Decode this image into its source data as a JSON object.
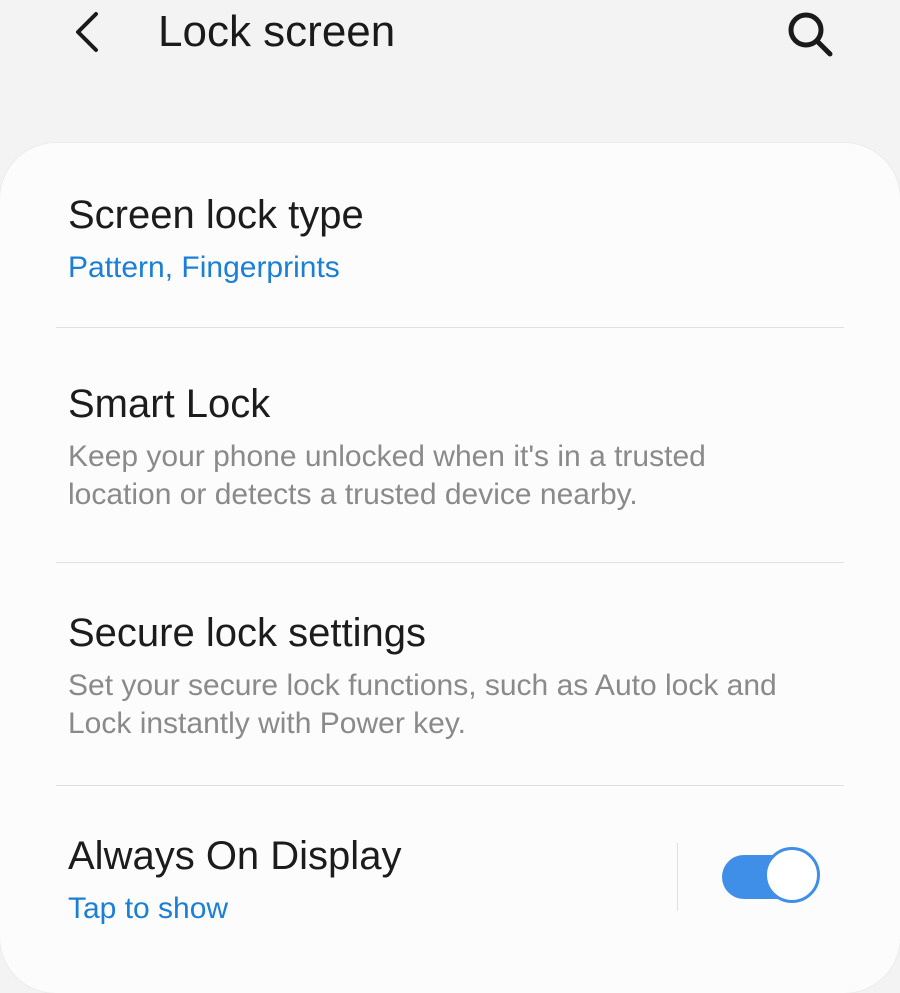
{
  "header": {
    "title": "Lock screen",
    "back_icon": "chevron-left-icon",
    "search_icon": "search-icon"
  },
  "settings": [
    {
      "title": "Screen lock type",
      "summary": "Pattern, Fingerprints",
      "summary_style": "accent"
    },
    {
      "title": "Smart Lock",
      "summary": "Keep your phone unlocked when it's in a trusted location or detects a trusted device nearby.",
      "summary_style": "secondary"
    },
    {
      "title": "Secure lock settings",
      "summary": "Set your secure lock functions, such as Auto lock and Lock instantly with Power key.",
      "summary_style": "secondary"
    },
    {
      "title": "Always On Display",
      "summary": "Tap to show",
      "summary_style": "accent",
      "toggle_on": true
    }
  ],
  "colors": {
    "background": "#f3f3f3",
    "card": "#fcfcfc",
    "accent": "#1a7fd6",
    "switch_on": "#3f8ee8",
    "title_text": "#1c1c1c",
    "summary_text": "#8a8a8a"
  }
}
